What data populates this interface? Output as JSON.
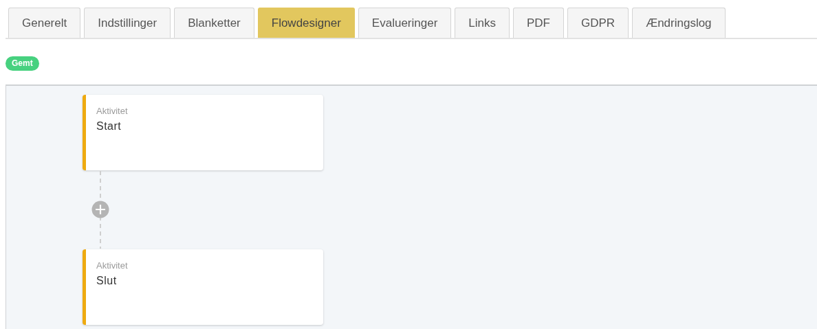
{
  "tabs": [
    {
      "label": "Generelt",
      "selected": false
    },
    {
      "label": "Indstillinger",
      "selected": false
    },
    {
      "label": "Blanketter",
      "selected": false
    },
    {
      "label": "Flowdesigner",
      "selected": true
    },
    {
      "label": "Evalueringer",
      "selected": false
    },
    {
      "label": "Links",
      "selected": false
    },
    {
      "label": "PDF",
      "selected": false
    },
    {
      "label": "GDPR",
      "selected": false
    },
    {
      "label": "Ændringslog",
      "selected": false
    }
  ],
  "status_badge": "Gemt",
  "flow": {
    "activities": [
      {
        "type": "Aktivitet",
        "name": "Start"
      },
      {
        "type": "Aktivitet",
        "name": "Slut"
      }
    ]
  }
}
